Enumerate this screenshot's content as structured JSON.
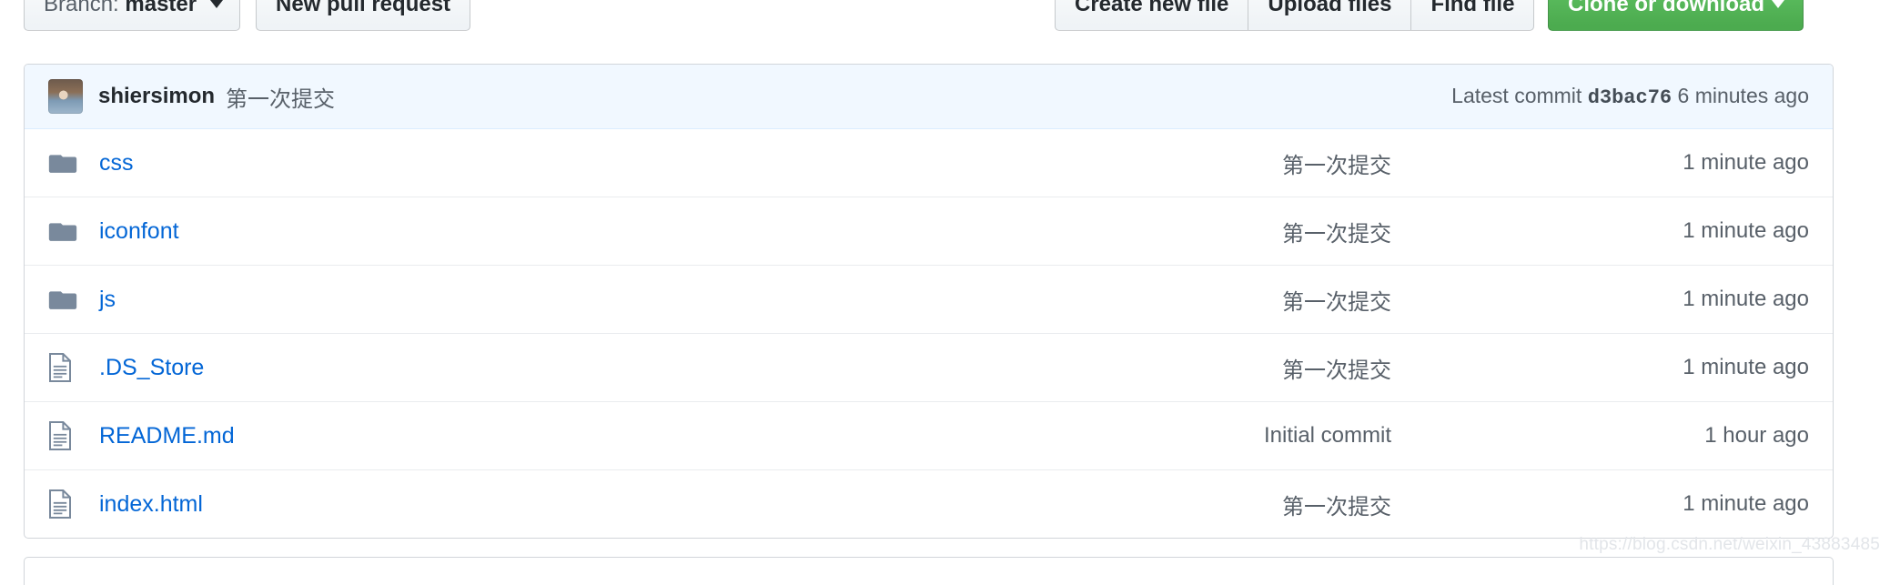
{
  "toolbar": {
    "branch_label": "Branch:",
    "branch_name": "master",
    "new_pull_request": "New pull request",
    "create_new_file": "Create new file",
    "upload_files": "Upload files",
    "find_file": "Find file",
    "clone_or_download": "Clone or download",
    "green_accent": "#4cab4f",
    "link_color": "#0366d6"
  },
  "commit_bar": {
    "author": "shiersimon",
    "message": "第一次提交",
    "latest_commit_label": "Latest commit",
    "sha": "d3bac76",
    "age": "6 minutes ago"
  },
  "files": [
    {
      "icon": "folder-icon",
      "type": "folder",
      "name": "css",
      "message": "第一次提交",
      "age": "1 minute ago"
    },
    {
      "icon": "folder-icon",
      "type": "folder",
      "name": "iconfont",
      "message": "第一次提交",
      "age": "1 minute ago"
    },
    {
      "icon": "folder-icon",
      "type": "folder",
      "name": "js",
      "message": "第一次提交",
      "age": "1 minute ago"
    },
    {
      "icon": "file-icon",
      "type": "file",
      "name": ".DS_Store",
      "message": "第一次提交",
      "age": "1 minute ago"
    },
    {
      "icon": "file-icon",
      "type": "file",
      "name": "README.md",
      "message": "Initial commit",
      "age": "1 hour ago"
    },
    {
      "icon": "file-icon",
      "type": "file",
      "name": "index.html",
      "message": "第一次提交",
      "age": "1 minute ago"
    }
  ],
  "watermark": "https://blog.csdn.net/weixin_43883485"
}
